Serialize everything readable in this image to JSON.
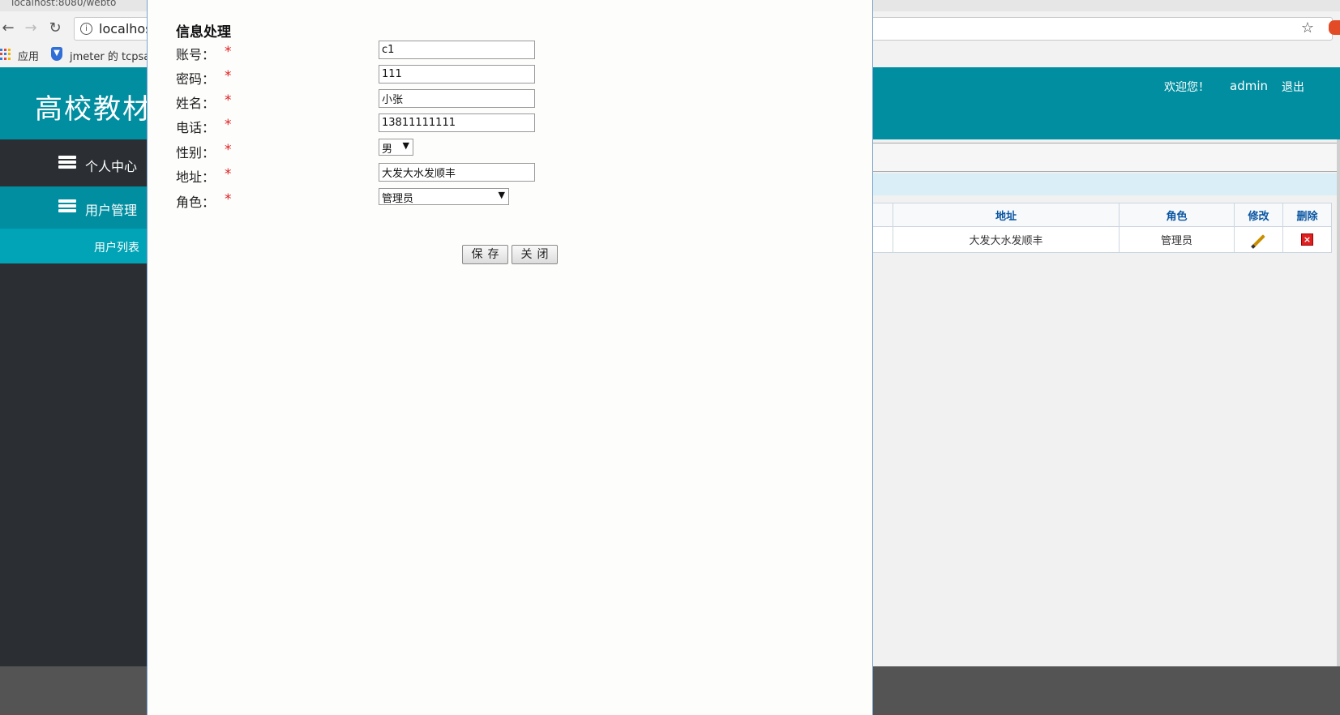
{
  "browser": {
    "tab_title": "localhost:8080/webto",
    "url": "localhos",
    "bookmarks": [
      "应用",
      "jmeter 的 tcpsa"
    ],
    "icons": [
      "back-icon",
      "forward-icon",
      "reload-icon",
      "info-icon",
      "star-icon"
    ]
  },
  "header": {
    "title": "高校教材",
    "welcome": "欢迎您！",
    "user": "admin",
    "logout": "退出"
  },
  "sidebar": {
    "items": [
      {
        "label": "个人中心"
      },
      {
        "label": "用户管理"
      }
    ],
    "subitems": [
      {
        "label": "用户列表"
      }
    ]
  },
  "table": {
    "columns": [
      "地址",
      "角色",
      "修改",
      "删除"
    ],
    "rows": [
      {
        "address": "大发大水发顺丰",
        "role": "管理员"
      }
    ]
  },
  "dialog": {
    "title": "信息处理",
    "fields": [
      {
        "label": "账号：",
        "value": "c1"
      },
      {
        "label": "密码：",
        "value": "111"
      },
      {
        "label": "姓名：",
        "value": "小张"
      },
      {
        "label": "电话：",
        "value": "13811111111"
      },
      {
        "label": "性别：",
        "value": "男"
      },
      {
        "label": "地址：",
        "value": "大发大水发顺丰"
      },
      {
        "label": "角色：",
        "value": "管理员"
      }
    ],
    "save_label": "保存",
    "close_label": "关闭"
  },
  "colors": {
    "header": "#008ea0",
    "sidebar": "#2b2f33",
    "required": "#e02020"
  }
}
